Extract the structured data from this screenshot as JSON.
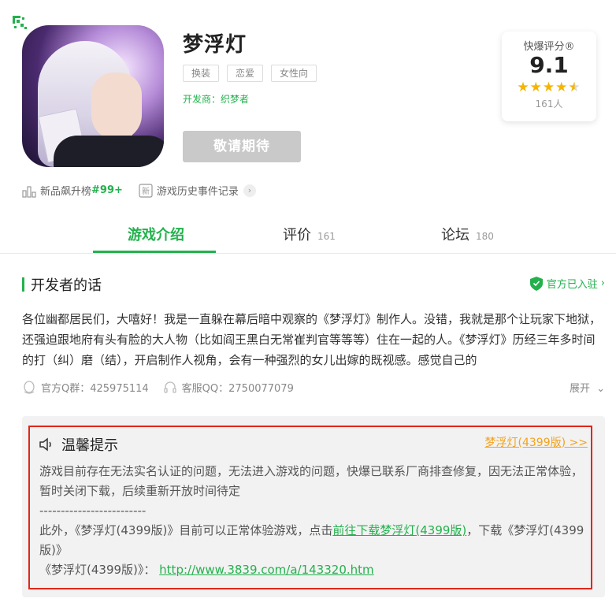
{
  "game": {
    "title": "梦浮灯",
    "tags": [
      "换装",
      "恋爱",
      "女性向"
    ],
    "developer": "开发商：织梦者",
    "action_button": "敬请期待"
  },
  "score": {
    "label": "快爆评分®",
    "value": "9.1",
    "rating": 4.5,
    "max_rating": 5,
    "count": "161人"
  },
  "meta": {
    "rank_label": "新品飙升榜",
    "rank_value": "#99+",
    "history_label": "游戏历史事件记录"
  },
  "tabs": [
    {
      "label": "游戏介绍",
      "count": ""
    },
    {
      "label": "评价",
      "count": "161"
    },
    {
      "label": "论坛",
      "count": "180"
    }
  ],
  "dev_section": {
    "title": "开发者的话",
    "official": "官方已入驻",
    "text": "各位幽都居民们，大嘻好！我是一直躲在幕后暗中观察的《梦浮灯》制作人。没错，我就是那个让玩家下地狱，还强迫跟地府有头有脸的大人物（比如阎王黑白无常崔判官等等等）住在一起的人。《梦浮灯》历经三年多时间的打（纠）磨（结），开启制作人视角，会有一种强烈的女儿出嫁的既视感。感觉自己的",
    "qq_group": "官方Q群：425975114",
    "service_qq": "客服QQ：2750077079",
    "expand": "展开"
  },
  "tip": {
    "title": "温馨提示",
    "right_link": "梦浮灯(4399版) >>",
    "paragraph1": "游戏目前存在无法实名认证的问题，无法进入游戏的问题，快爆已联系厂商排查修复，因无法正常体验，暂时关闭下载，后续重新开放时间待定",
    "separator": "-------------------------",
    "paragraph2_pre": "此外，《梦浮灯(4399版)》目前可以正常体验游戏，点击",
    "paragraph2_link": "前往下载梦浮灯(4399版)",
    "paragraph2_post": "，下载《梦浮灯(4399版)》",
    "url_label": "《梦浮灯(4399版)》：",
    "url": "http://www.3839.com/a/143320.htm"
  },
  "colors": {
    "accent": "#23b14d",
    "warning_border": "#e0261b",
    "link_orange": "#f3a21c",
    "star": "#f5b400"
  }
}
